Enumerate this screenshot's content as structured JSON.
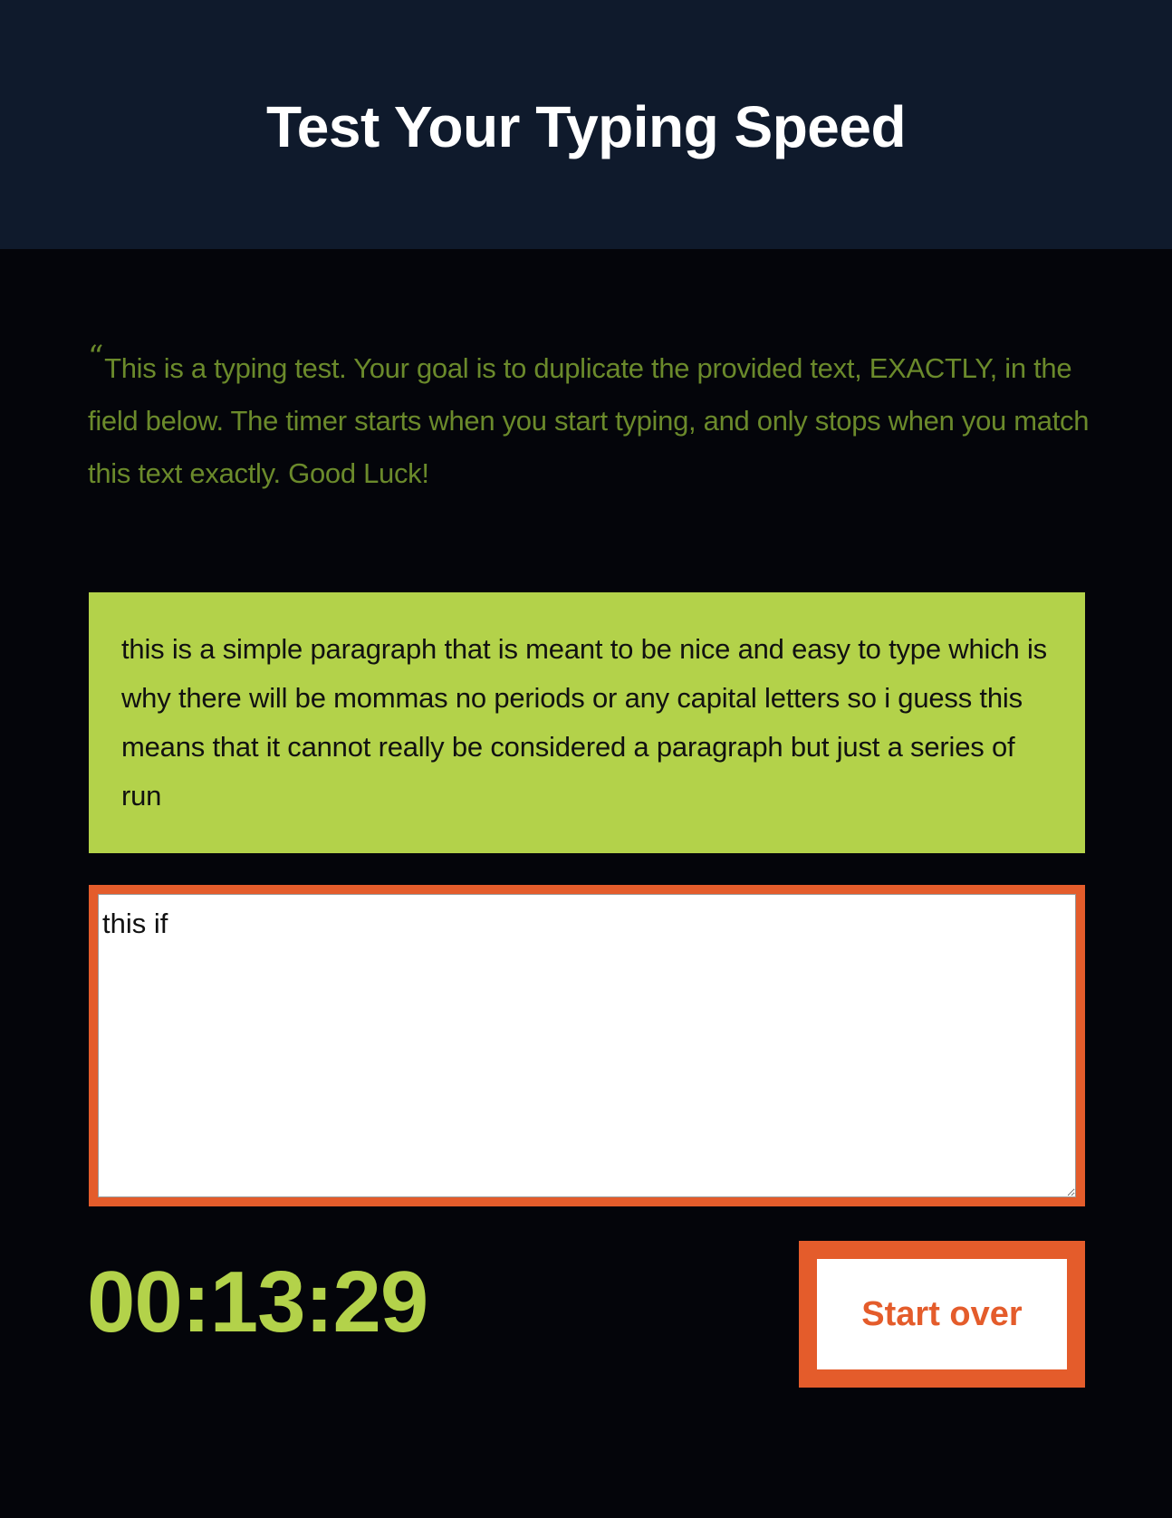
{
  "header": {
    "title": "Test Your Typing Speed"
  },
  "intro": {
    "quote_mark": "“",
    "text": "This is a typing test. Your goal is to duplicate the provided text, EXACTLY, in the field below. The timer starts when you start typing, and only stops when you match this text exactly. Good Luck!"
  },
  "origin": {
    "text": "this is a simple paragraph that is meant to be nice and easy to type which is why there will be mommas no periods or any capital letters so i guess this means that it cannot really be considered a paragraph but just a series of run"
  },
  "test_area": {
    "value": "this if"
  },
  "timer": {
    "value": "00:13:29"
  },
  "reset_button": {
    "label": "Start over"
  },
  "colors": {
    "header_bg": "#0f1a2c",
    "page_bg": "#04050a",
    "accent_green": "#b3d24a",
    "intro_text": "#6b8a2b",
    "accent_orange": "#e45c2b"
  }
}
